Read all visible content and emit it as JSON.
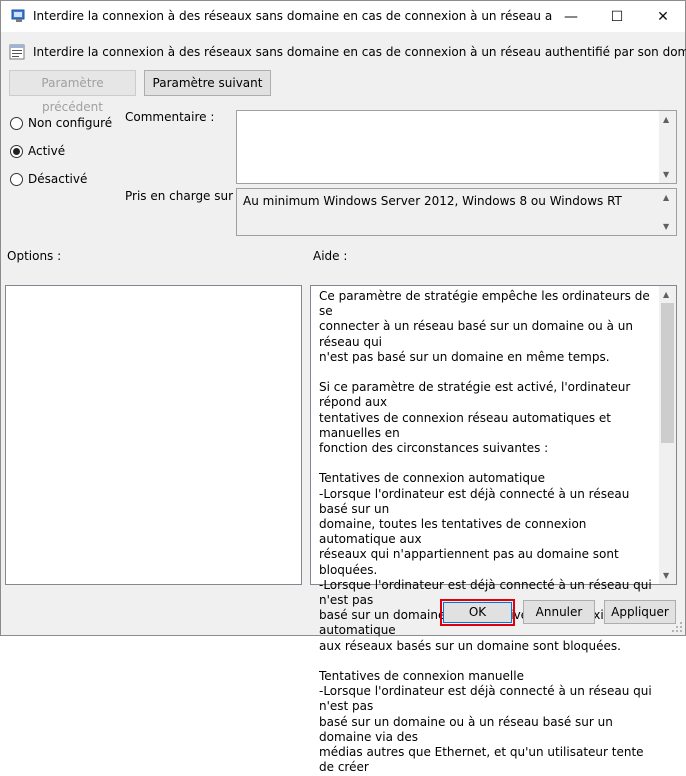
{
  "window": {
    "title": "Interdire la connexion à des réseaux sans domaine en cas de connexion à un réseau authentifié ...",
    "minimize_glyph": "—",
    "maximize_glyph": "☐",
    "close_glyph": "✕"
  },
  "header": {
    "title": "Interdire la connexion à des réseaux sans domaine en cas de connexion à un réseau authentifié par son domaine"
  },
  "nav": {
    "previous_label": "Paramètre précédent",
    "next_label": "Paramètre suivant"
  },
  "state": {
    "options": [
      {
        "label": "Non configuré",
        "checked": false
      },
      {
        "label": "Activé",
        "checked": true
      },
      {
        "label": "Désactivé",
        "checked": false
      }
    ]
  },
  "comment": {
    "label": "Commentaire :",
    "value": ""
  },
  "supported": {
    "label": "Pris en charge sur :",
    "value": "Au minimum Windows Server 2012, Windows 8 ou Windows RT"
  },
  "options_panel": {
    "label": "Options :"
  },
  "help_panel": {
    "label": "Aide :",
    "text": "Ce paramètre de stratégie empêche les ordinateurs de se\nconnecter à un réseau basé sur un domaine ou à un réseau qui\nn'est pas basé sur un domaine en même temps.\n\nSi ce paramètre de stratégie est activé, l'ordinateur répond aux\ntentatives de connexion réseau automatiques et manuelles en\nfonction des circonstances suivantes :\n\nTentatives de connexion automatique\n-Lorsque l'ordinateur est déjà connecté à un réseau basé sur un\ndomaine, toutes les tentatives de connexion automatique aux\nréseaux qui n'appartiennent pas au domaine sont bloquées.\n-Lorsque l'ordinateur est déjà connecté à un réseau qui n'est pas\nbasé sur un domaine, les tentatives de connexion automatique\naux réseaux basés sur un domaine sont bloquées.\n\nTentatives de connexion manuelle\n-Lorsque l'ordinateur est déjà connecté à un réseau qui n'est pas\nbasé sur un domaine ou à un réseau basé sur un domaine via des\nmédias autres que Ethernet, et qu'un utilisateur tente de créer"
  },
  "footer": {
    "ok_label": "OK",
    "cancel_label": "Annuler",
    "apply_label": "Appliquer"
  },
  "colors": {
    "highlight": "#e0000d",
    "dialog_bg": "#f0f0f0"
  }
}
